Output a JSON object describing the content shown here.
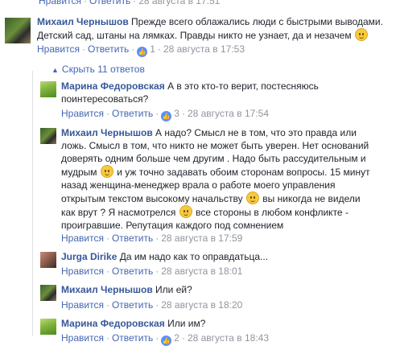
{
  "top_meta": {
    "like": "Нравится",
    "reply": "Ответить",
    "date": "28 августа в 17:51"
  },
  "main_comment": {
    "author": "Михаил Чернышов",
    "line1": "Прежде всего облажались люди с быстрыми выводами.",
    "line2": "Детский сад, штаны на лямках. Правды никто не узнает, да и незачем",
    "like": "Нравится",
    "reply": "Ответить",
    "likes": "1",
    "date": "28 августа в 17:53"
  },
  "toggle": {
    "label": "Скрыть 11 ответов"
  },
  "replies": [
    {
      "author": "Марина Федоровская",
      "line1": "А в это кто-то верит, постесняюсь",
      "line2": "поинтересоваться?",
      "like": "Нравится",
      "reply": "Ответить",
      "likes": "3",
      "date": "28 августа в 17:54"
    },
    {
      "author": "Михаил Чернышов",
      "line1": "А надо? Смысл не в том, что это правда или",
      "line2": "ложь. Смысл в том, что никто не может быть уверен. Нет оснований",
      "line3": "доверять одним больше чем другим . Надо быть рассудительным и",
      "line4a": "мудрым",
      "line4b": "и уж точно задавать обоим сторонам вопросы. 15 минут",
      "line5": "назад женщина-менеджер врала о работе моего управления",
      "line6a": "открытым текстом высокому начальству",
      "line6b": "вы никогда не видели",
      "line7a": "как врут ? Я насмотрелся",
      "line7b": "все стороны в любом конфликте -",
      "line8": "проигравшие. Репутация каждого под сомнением",
      "like": "Нравится",
      "reply": "Ответить",
      "date": "28 августа в 17:59"
    },
    {
      "author": "Jurga Dirike",
      "text": "Да им надо как то оправдатьца...",
      "like": "Нравится",
      "reply": "Ответить",
      "date": "28 августа в 18:01"
    },
    {
      "author": "Михаил Чернышов",
      "text": "Или ей?",
      "like": "Нравится",
      "reply": "Ответить",
      "date": "28 августа в 18:20"
    },
    {
      "author": "Марина Федоровская",
      "text": "Или им?",
      "like": "Нравится",
      "reply": "Ответить",
      "likes": "2",
      "date": "28 августа в 18:43"
    }
  ]
}
